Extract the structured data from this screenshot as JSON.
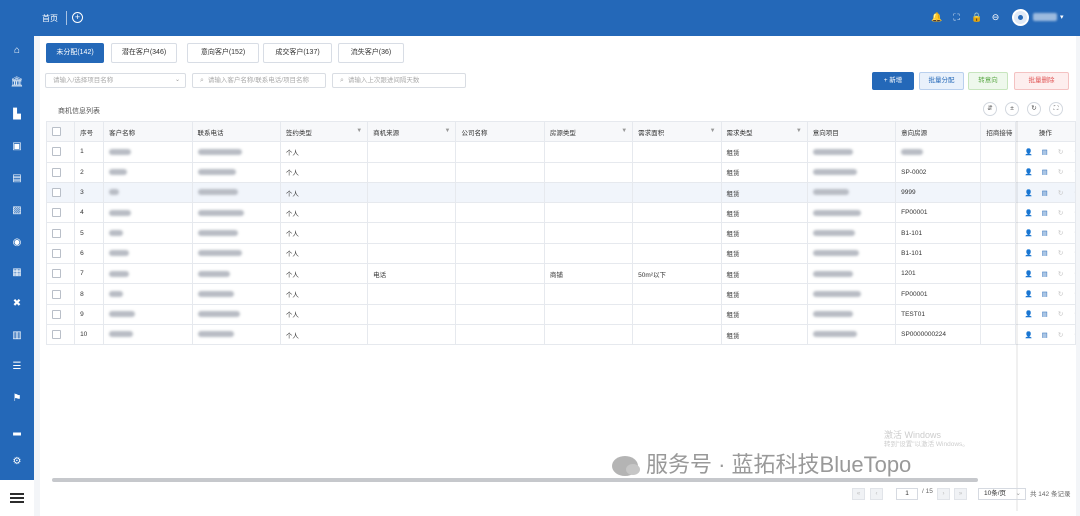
{
  "topbar": {
    "home_label": "首页",
    "plus_icon": "add-tab-icon",
    "icons": [
      "bell-icon",
      "fullscreen-icon",
      "lock-icon",
      "help-icon"
    ],
    "accent": "#2468b8"
  },
  "sidebar": {
    "icons": [
      "home-icon",
      "bank-icon",
      "building-icon",
      "briefcase-icon",
      "table-icon",
      "photo-icon",
      "broadcast-icon",
      "document-icon",
      "tools-icon",
      "contract-icon",
      "list-icon",
      "flag-icon",
      "chart-icon",
      "settings-icon"
    ]
  },
  "tabs": [
    {
      "label": "未分配(142)"
    },
    {
      "label": "潜在客户(346)"
    },
    {
      "label": "意向客户(152)"
    },
    {
      "label": "成交客户(137)"
    },
    {
      "label": "流失客户(36)"
    }
  ],
  "search": {
    "project": {
      "placeholder": "请输入/选择项目名称"
    },
    "keyword": {
      "placeholder": "请输入客户名称/联系电话/项目名称"
    },
    "days": {
      "placeholder": "请输入上次跟进间隔天数"
    }
  },
  "actions": {
    "new_label": "+ 新增",
    "assign_label": "批量分配",
    "convert_label": "转意向",
    "delete_label": "批量删除"
  },
  "list": {
    "title": "商机信息列表",
    "tool_icons": [
      "column-settings-icon",
      "export-icon",
      "refresh-icon",
      "fullscreen-icon"
    ]
  },
  "table": {
    "headers": {
      "index": "序号",
      "customer": "客户名称",
      "phone": "联系电话",
      "sign_type": "签约类型",
      "source": "商机来源",
      "company": "公司名称",
      "house_type": "房源类型",
      "area": "需求面积",
      "demand_type": "需求类型",
      "project": "意向项目",
      "house": "意向房源",
      "merchant": "招商接待",
      "ops": "操作"
    },
    "rows": [
      {
        "index": "1",
        "sign_type": "个人",
        "source": "",
        "company": "",
        "house_type": "",
        "area": "",
        "demand_type": "租赁",
        "house": ""
      },
      {
        "index": "2",
        "sign_type": "个人",
        "source": "",
        "company": "",
        "house_type": "",
        "area": "",
        "demand_type": "租赁",
        "house": "SP-0002"
      },
      {
        "index": "3",
        "sign_type": "个人",
        "source": "",
        "company": "",
        "house_type": "",
        "area": "",
        "demand_type": "租赁",
        "house": "9999"
      },
      {
        "index": "4",
        "sign_type": "个人",
        "source": "",
        "company": "",
        "house_type": "",
        "area": "",
        "demand_type": "租赁",
        "house": "FP00001"
      },
      {
        "index": "5",
        "sign_type": "个人",
        "source": "",
        "company": "",
        "house_type": "",
        "area": "",
        "demand_type": "租赁",
        "house": "B1-101"
      },
      {
        "index": "6",
        "sign_type": "个人",
        "source": "",
        "company": "",
        "house_type": "",
        "area": "",
        "demand_type": "租赁",
        "house": "B1-101"
      },
      {
        "index": "7",
        "sign_type": "个人",
        "source": "电话",
        "company": "",
        "house_type": "商铺",
        "area": "50m²以下",
        "demand_type": "租赁",
        "house": "1201"
      },
      {
        "index": "8",
        "sign_type": "个人",
        "source": "",
        "company": "",
        "house_type": "",
        "area": "",
        "demand_type": "租赁",
        "house": "FP00001"
      },
      {
        "index": "9",
        "sign_type": "个人",
        "source": "",
        "company": "",
        "house_type": "",
        "area": "",
        "demand_type": "租赁",
        "house": "TEST01"
      },
      {
        "index": "10",
        "sign_type": "个人",
        "source": "",
        "company": "",
        "house_type": "",
        "area": "",
        "demand_type": "租赁",
        "house": "SP0000000224"
      }
    ],
    "row_op_icons": [
      "assign-user-icon",
      "detail-doc-icon",
      "refresh-icon",
      "link-icon"
    ]
  },
  "pagination": {
    "current_page": "1",
    "total_pages": "/ 15",
    "page_size": "10条/页",
    "total": "共 142 条记录"
  },
  "watermarks": {
    "windows_line1": "激活 Windows",
    "windows_line2": "转到\"设置\"以激活 Windows。",
    "brand": "服务号 · 蓝拓科技BlueTopo"
  }
}
